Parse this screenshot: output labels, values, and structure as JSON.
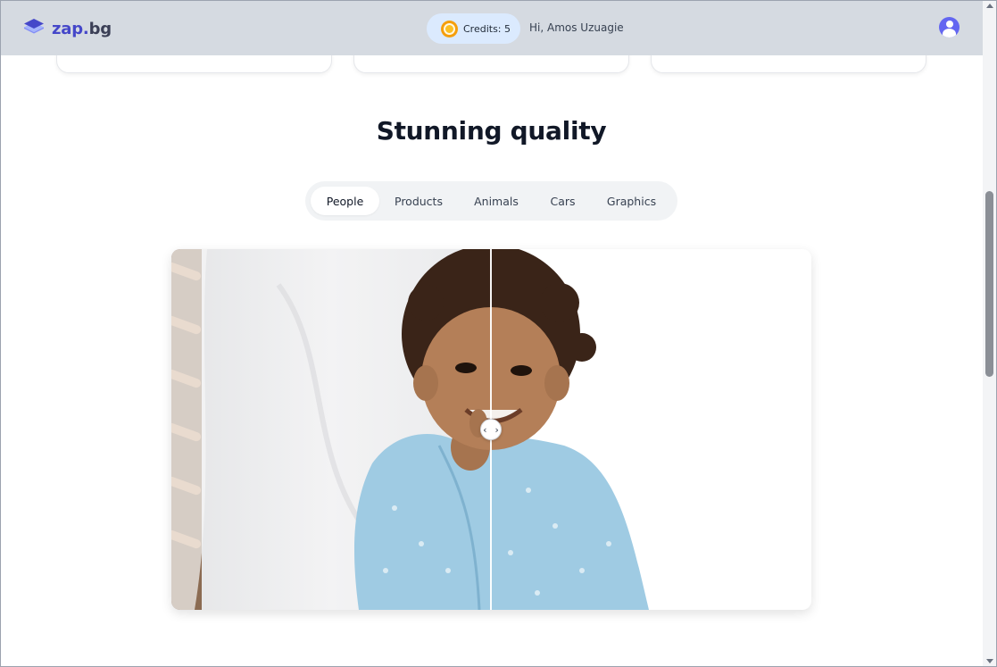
{
  "header": {
    "logo_name": "zap",
    "logo_dot": ".",
    "logo_tld": "bg",
    "credits_label": "Credits: 5",
    "greeting": "Hi, Amos Uzuagie"
  },
  "section": {
    "title": "Stunning quality",
    "tabs": [
      {
        "label": "People",
        "active": true
      },
      {
        "label": "Products",
        "active": false
      },
      {
        "label": "Animals",
        "active": false
      },
      {
        "label": "Cars",
        "active": false
      },
      {
        "label": "Graphics",
        "active": false
      }
    ]
  },
  "comparison": {
    "slider_position_pct": 50,
    "handle_glyph": "‹ ›"
  },
  "colors": {
    "header_bg": "#d5dae1",
    "brand": "#4547c9",
    "credits_bg": "#dbeafe",
    "avatar": "#6366f1"
  },
  "icons": [
    "logo-icon",
    "coin-icon",
    "user-avatar-icon",
    "compare-handle-icon"
  ]
}
